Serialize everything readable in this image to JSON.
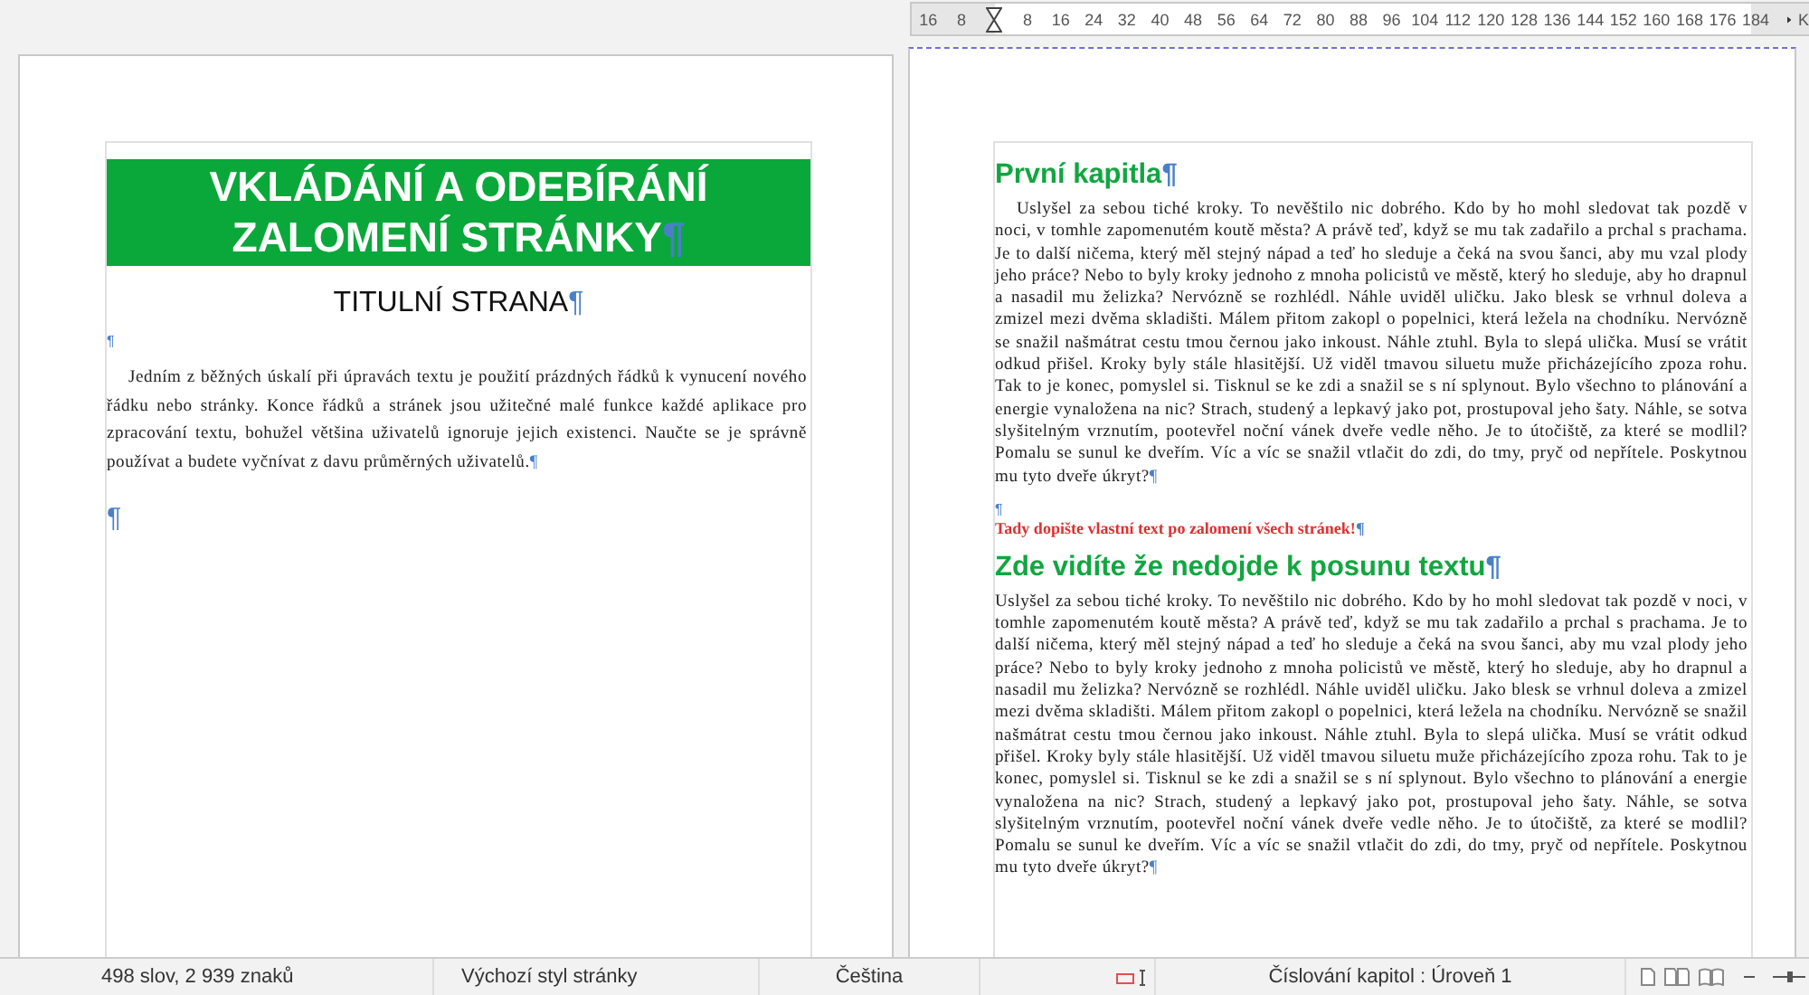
{
  "ruler": {
    "ticks": [
      {
        "kind": "number",
        "label": "16"
      },
      {
        "kind": "number",
        "label": "8"
      },
      {
        "kind": "marker"
      },
      "8",
      "16",
      "24",
      "32",
      "40",
      "48",
      "56",
      "64",
      "72",
      "80",
      "88",
      "96",
      "104",
      "112",
      "120",
      "128",
      "136",
      "144",
      "152",
      "160",
      "168",
      "176",
      "184"
    ],
    "tail": "K"
  },
  "pages": [
    {
      "blocks": [
        {
          "kind": "banner",
          "text": "VKLÁDÁNÍ A ODEBÍRÁNÍ ZALOMENÍ STRÁNKY",
          "mark": "¶"
        },
        {
          "kind": "title",
          "text": "TITULNÍ STRANA",
          "mark": "¶"
        },
        {
          "kind": "empty",
          "mark": "¶"
        },
        {
          "kind": "body",
          "indent": true,
          "text": "Jedním z běžných úskalí při úpravách textu je použití prázdných řádků k vynucení nového řádku nebo stránky. Konce řádků a stránek jsou užitečné malé funkce každé aplikace pro zpracování textu, bohužel většina uživatelů ignoruje jejich existenci. Naučte se je správně používat a budete vyčnívat z davu průměrných uživatelů.",
          "mark": "¶"
        },
        {
          "kind": "break",
          "mark": "¶"
        }
      ]
    },
    {
      "blocks": [
        {
          "kind": "heading",
          "text": "První kapitla",
          "mark": "¶"
        },
        {
          "kind": "body",
          "indent": true,
          "text": "Uslyšel za sebou tiché kroky. To nevěštilo nic dobrého. Kdo by ho mohl sledovat tak pozdě v noci, v tomhle zapomenutém koutě města? A právě teď, když se mu tak zadařilo a prchal s prachama. Je to další ničema, který měl stejný nápad a teď ho sleduje a čeká na svou šanci, aby mu vzal plody jeho práce? Nebo to byly kroky jednoho z mnoha policistů ve městě, který ho sleduje, aby ho drapnul a nasadil mu želizka? Nervózně se rozhlédl. Náhle uviděl uličku. Jako blesk se vrhnul doleva a zmizel mezi dvěma skladišti. Málem přitom zakopl o popelnici, která ležela na chodníku. Nervózně se snažil našmátrat cestu tmou černou jako inkoust. Náhle ztuhl. Byla to slepá ulička. Musí se vrátit odkud přišel. Kroky byly stále hlasitější. Už viděl tmavou siluetu muže přicházejícího zpoza rohu. Tak to je konec, pomyslel si. Tisknul se ke zdi a snažil se s ní splynout. Bylo všechno to plánování a energie vynaložena na nic? Strach, studený a lepkavý jako pot, prostupoval jeho šaty. Náhle, se sotva slyšitelným vrznutím, pootevřel noční vánek dveře vedle něho. Je to útočiště, za které se modlil? Pomalu se sunul ke dveřím. Víc a víc se snažil vtlačit do zdi, do tmy, pryč od nepřítele. Poskytnou mu tyto dveře úkryt?",
          "mark": "¶"
        },
        {
          "kind": "empty",
          "mark": "¶"
        },
        {
          "kind": "note",
          "text": "Tady dopište vlastní text po zalomení všech stránek!",
          "mark": "¶"
        },
        {
          "kind": "heading",
          "text": "Zde vidíte že nedojde k posunu textu",
          "mark": "¶"
        },
        {
          "kind": "body",
          "indent": false,
          "text": "Uslyšel za sebou tiché kroky. To nevěštilo nic dobrého. Kdo by ho mohl sledovat tak pozdě v noci, v tomhle zapomenutém koutě města? A právě teď, když se mu tak zadařilo a prchal s prachama. Je to další ničema, který měl stejný nápad a teď ho sleduje a čeká na svou šanci, aby mu vzal plody jeho práce? Nebo to byly kroky jednoho z mnoha policistů ve městě, který ho sleduje, aby ho drapnul a nasadil mu želizka? Nervózně se rozhlédl. Náhle uviděl uličku. Jako blesk se vrhnul doleva a zmizel mezi dvěma skladišti. Málem přitom zakopl o popelnici, která ležela na chodníku. Nervózně se snažil našmátrat cestu tmou černou jako inkoust. Náhle ztuhl. Byla to slepá ulička. Musí se vrátit odkud přišel. Kroky byly stále hlasitější. Už viděl tmavou siluetu muže přicházejícího zpoza rohu. Tak to je konec, pomyslel si. Tisknul se ke zdi a snažil se s ní splynout. Bylo všechno to plánování a energie vynaložena na nic? Strach, studený a lepkavý jako pot, prostupoval jeho šaty. Náhle, se sotva slyšitelným vrznutím, pootevřel noční vánek dveře vedle něho. Je to útočiště, za které se modlil? Pomalu se sunul ke dveřím. Víc a víc se snažil vtlačit do zdi, do tmy, pryč od nepřítele. Poskytnou mu tyto dveře úkryt?",
          "mark": "¶"
        }
      ]
    }
  ],
  "status_bar": {
    "word_count": "498 slov, 2 939 znaků",
    "page_style": "Výchozí styl stránky",
    "language": "Čeština",
    "outline": "Číslování kapitol : Úroveň 1"
  }
}
